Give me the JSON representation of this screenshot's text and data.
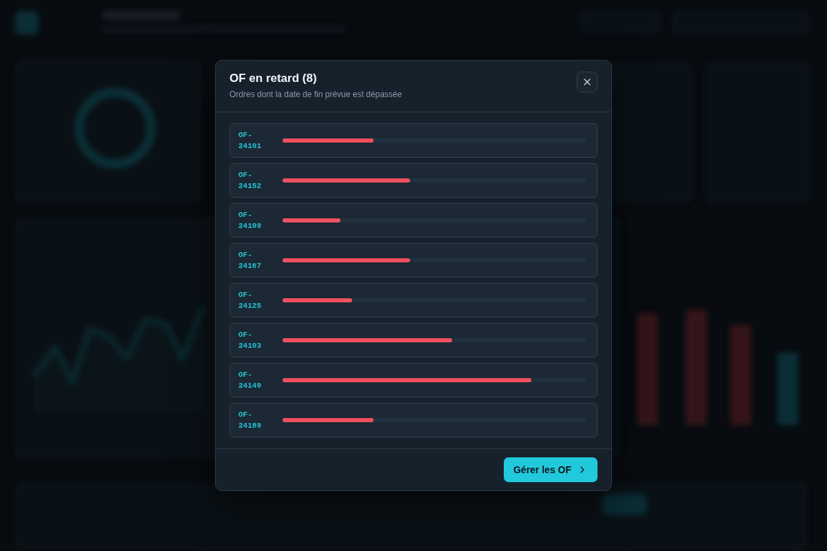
{
  "dialog": {
    "title": "OF en retard (8)",
    "subtitle": "Ordres dont la date de fin prévue est dépassée",
    "orders": [
      {
        "id": "OF-24101",
        "level": 0.3
      },
      {
        "id": "OF-24152",
        "level": 0.42
      },
      {
        "id": "OF-24109",
        "level": 0.19
      },
      {
        "id": "OF-24167",
        "level": 0.42
      },
      {
        "id": "OF-24125",
        "level": 0.23
      },
      {
        "id": "OF-24103",
        "level": 0.56
      },
      {
        "id": "OF-24149",
        "level": 0.82
      },
      {
        "id": "OF-24189",
        "level": 0.3
      }
    ],
    "action": "Gérer les OF"
  }
}
